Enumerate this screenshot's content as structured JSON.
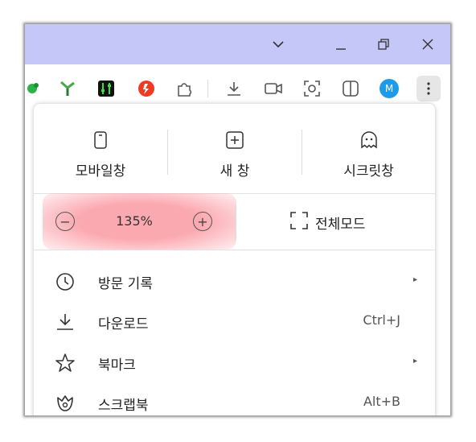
{
  "menu": {
    "top_actions": [
      {
        "label": "모바일창",
        "icon": "mobile-window-icon"
      },
      {
        "label": "새 창",
        "icon": "new-window-icon"
      },
      {
        "label": "시크릿창",
        "icon": "secret-window-icon"
      }
    ],
    "zoom": {
      "minus": "−",
      "level": "135%",
      "plus": "+"
    },
    "fullscreen_label": "전체모드",
    "items": [
      {
        "label": "방문 기록",
        "icon": "history-clock-icon",
        "shortcut": "",
        "submenu": "▸"
      },
      {
        "label": "다운로드",
        "icon": "download-icon",
        "shortcut": "Ctrl+J",
        "submenu": ""
      },
      {
        "label": "북마크",
        "icon": "star-icon",
        "shortcut": "",
        "submenu": "▸"
      },
      {
        "label": "스크랩북",
        "icon": "scrapbook-icon",
        "shortcut": "Alt+B",
        "submenu": ""
      }
    ]
  },
  "toolbar": {
    "profile_initial": "M"
  },
  "colors": {
    "titlebar": "#c4c7f8",
    "zoom_highlight": "#f88c96",
    "profile": "#1e9be8"
  }
}
